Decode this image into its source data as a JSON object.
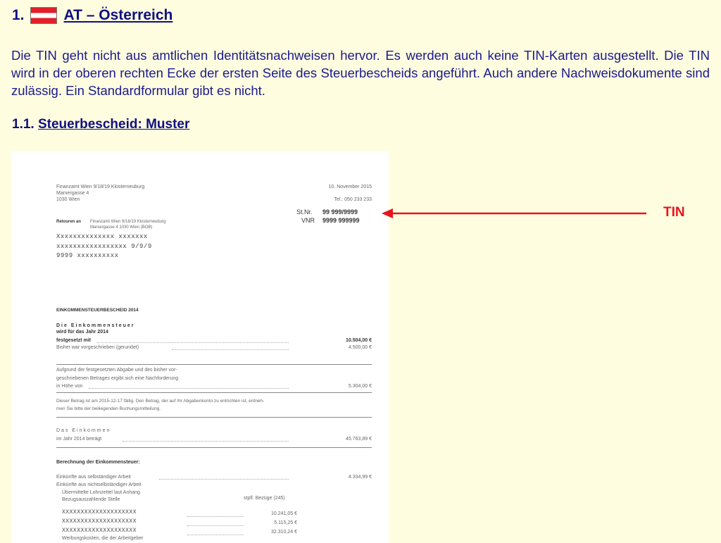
{
  "heading": {
    "number": "1.",
    "title": "AT – Österreich",
    "flag_colors": [
      "#e0202a",
      "#ffffff",
      "#e0202a"
    ]
  },
  "intro_text": "Die TIN geht nicht aus amtlichen Identitätsnachweisen hervor. Es werden auch keine TIN-Karten ausgestellt. Die TIN wird in der oberen rechten Ecke der ersten Seite des Steuerbescheids angeführt. Auch andere Nachweisdokumente sind zulässig. Ein Standardformular gibt es nicht.",
  "subheading": {
    "number": "1.1.",
    "title": "Steuerbescheid: Muster"
  },
  "document": {
    "office_line1": "Finanzamt Wien 9/18/19 Klosterneuburg",
    "office_line2": "Marxergasse 4",
    "office_line3": "1030 Wien",
    "date": "10. November 2015",
    "phone": "Tel.: 050 233 233",
    "stnr_label": "St.Nr.",
    "stnr_value": "99 999/9999",
    "vnr_label": "VNR",
    "vnr_value": "9999 999999",
    "return_label": "Retouren an",
    "return_line1": "Finanzamt Wien 9/18/19 Klosterneuburg",
    "return_line2": "Marxergasse 4 1030 Wien (BOB)",
    "addressee_line1": "Xxxxxxxxxxxxxx xxxxxxx",
    "addressee_line2": "xxxxxxxxxxxxxxxxx 9/9/9",
    "addressee_line3": "9999 xxxxxxxxxx",
    "doc_title": "EINKOMMENSTEUERBESCHEID 2014",
    "tax_line1": "Die Einkommensteuer",
    "tax_line2": "wird für das Jahr 2014",
    "tax_line3": "festgesetzt mit",
    "tax_amount": "10.504,00 €",
    "prev_label": "Bisher war vorgeschrieben (gerundet)",
    "prev_amount": "4.500,00 €",
    "basis_line1": "Aufgrund der festgesetzten Abgabe und des bisher vor-",
    "basis_line2": "geschriebenen Betrages ergibt sich eine Nachforderung",
    "basis_line3": "in Höhe von",
    "basis_amount": "5.304,00 €",
    "due_line1": "Dieser Betrag ist am 2015-12-17 fällig. Den Betrag, der auf Ihr Abgabenkonto zu entrichten ist, entneh-",
    "due_line2": "men Sie bitte der beiliegenden Buchungsmitteilung.",
    "income_line1": "Das Einkommen",
    "income_line2": "im Jahr 2014 beträgt",
    "income_amount": "45.763,89 €",
    "calc_title": "Berechnung der Einkommensteuer:",
    "calc_line1": "Einkünfte aus selbständiger Arbeit",
    "calc_amount1": "4.334,99 €",
    "calc_line2": "Einkünfte aus nichtselbständiger Arbeit",
    "calc_line3": "Übermittelte Lohnzettel laut Anhang",
    "calc_line4": "Bezugsauszahlende Stelle",
    "calc_col_label": "stpfl. Bezüge (245)",
    "row1_name": "XXXXXXXXXXXXXXXXXXXX",
    "row1_amount": "10.241,05 €",
    "row2_name": "XXXXXXXXXXXXXXXXXXXX",
    "row2_amount": "5.115,25 €",
    "row3_name": "XXXXXXXXXXXXXXXXXXXX",
    "row3_amount": "32.310,24 €",
    "footer_line": "Werbungskosten, die der Arbeitgeber"
  },
  "annotation": {
    "label": "TIN",
    "color": "#e8141e"
  }
}
